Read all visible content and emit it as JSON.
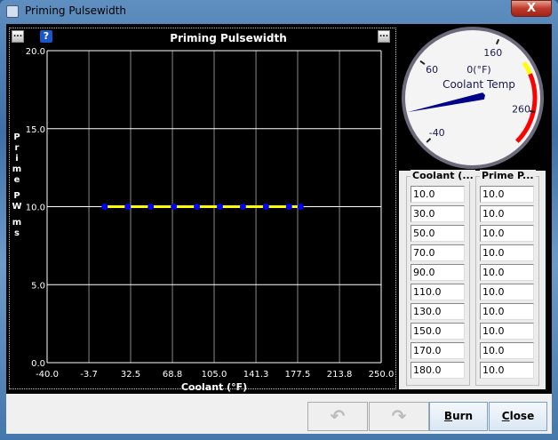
{
  "window": {
    "title": "Priming Pulsewidth",
    "close": "X"
  },
  "chart_panel": {
    "menu_left": "...",
    "help": "?",
    "menu_right": "..."
  },
  "chart_data": {
    "type": "line",
    "title": "Priming Pulsewidth",
    "xlabel": "Coolant (°F)",
    "ylabel": "Prime PW ms",
    "xlim": [
      -40,
      250
    ],
    "ylim": [
      0,
      20
    ],
    "x_ticks": [
      "-40.0",
      "-3.7",
      "32.5",
      "68.8",
      "105.0",
      "141.3",
      "177.5",
      "213.8",
      "250.0"
    ],
    "y_ticks": [
      "0.0",
      "5.0",
      "10.0",
      "15.0",
      "20.0"
    ],
    "grid": true,
    "x": [
      10,
      30,
      50,
      70,
      90,
      110,
      130,
      150,
      170,
      180
    ],
    "y": [
      10,
      10,
      10,
      10,
      10,
      10,
      10,
      10,
      10,
      10
    ],
    "line_color": "#ffff00",
    "point_color": "#0000ff"
  },
  "gauge": {
    "title": "Coolant Temp",
    "value_text": "0(°F)",
    "value": 0,
    "labels": [
      "-40",
      "60",
      "160",
      "260"
    ],
    "min": -40,
    "max": 300,
    "warn_color": "#ffff00",
    "danger_color": "#ff0000"
  },
  "table": {
    "headers": [
      "Coolant (...",
      "Prime P..."
    ],
    "coolant": [
      "10.0",
      "30.0",
      "50.0",
      "70.0",
      "90.0",
      "110.0",
      "130.0",
      "150.0",
      "170.0",
      "180.0"
    ],
    "prime": [
      "10.0",
      "10.0",
      "10.0",
      "10.0",
      "10.0",
      "10.0",
      "10.0",
      "10.0",
      "10.0",
      "10.0"
    ]
  },
  "buttons": {
    "burn_u": "B",
    "burn_rest": "urn",
    "close_u": "C",
    "close_rest": "lose"
  }
}
